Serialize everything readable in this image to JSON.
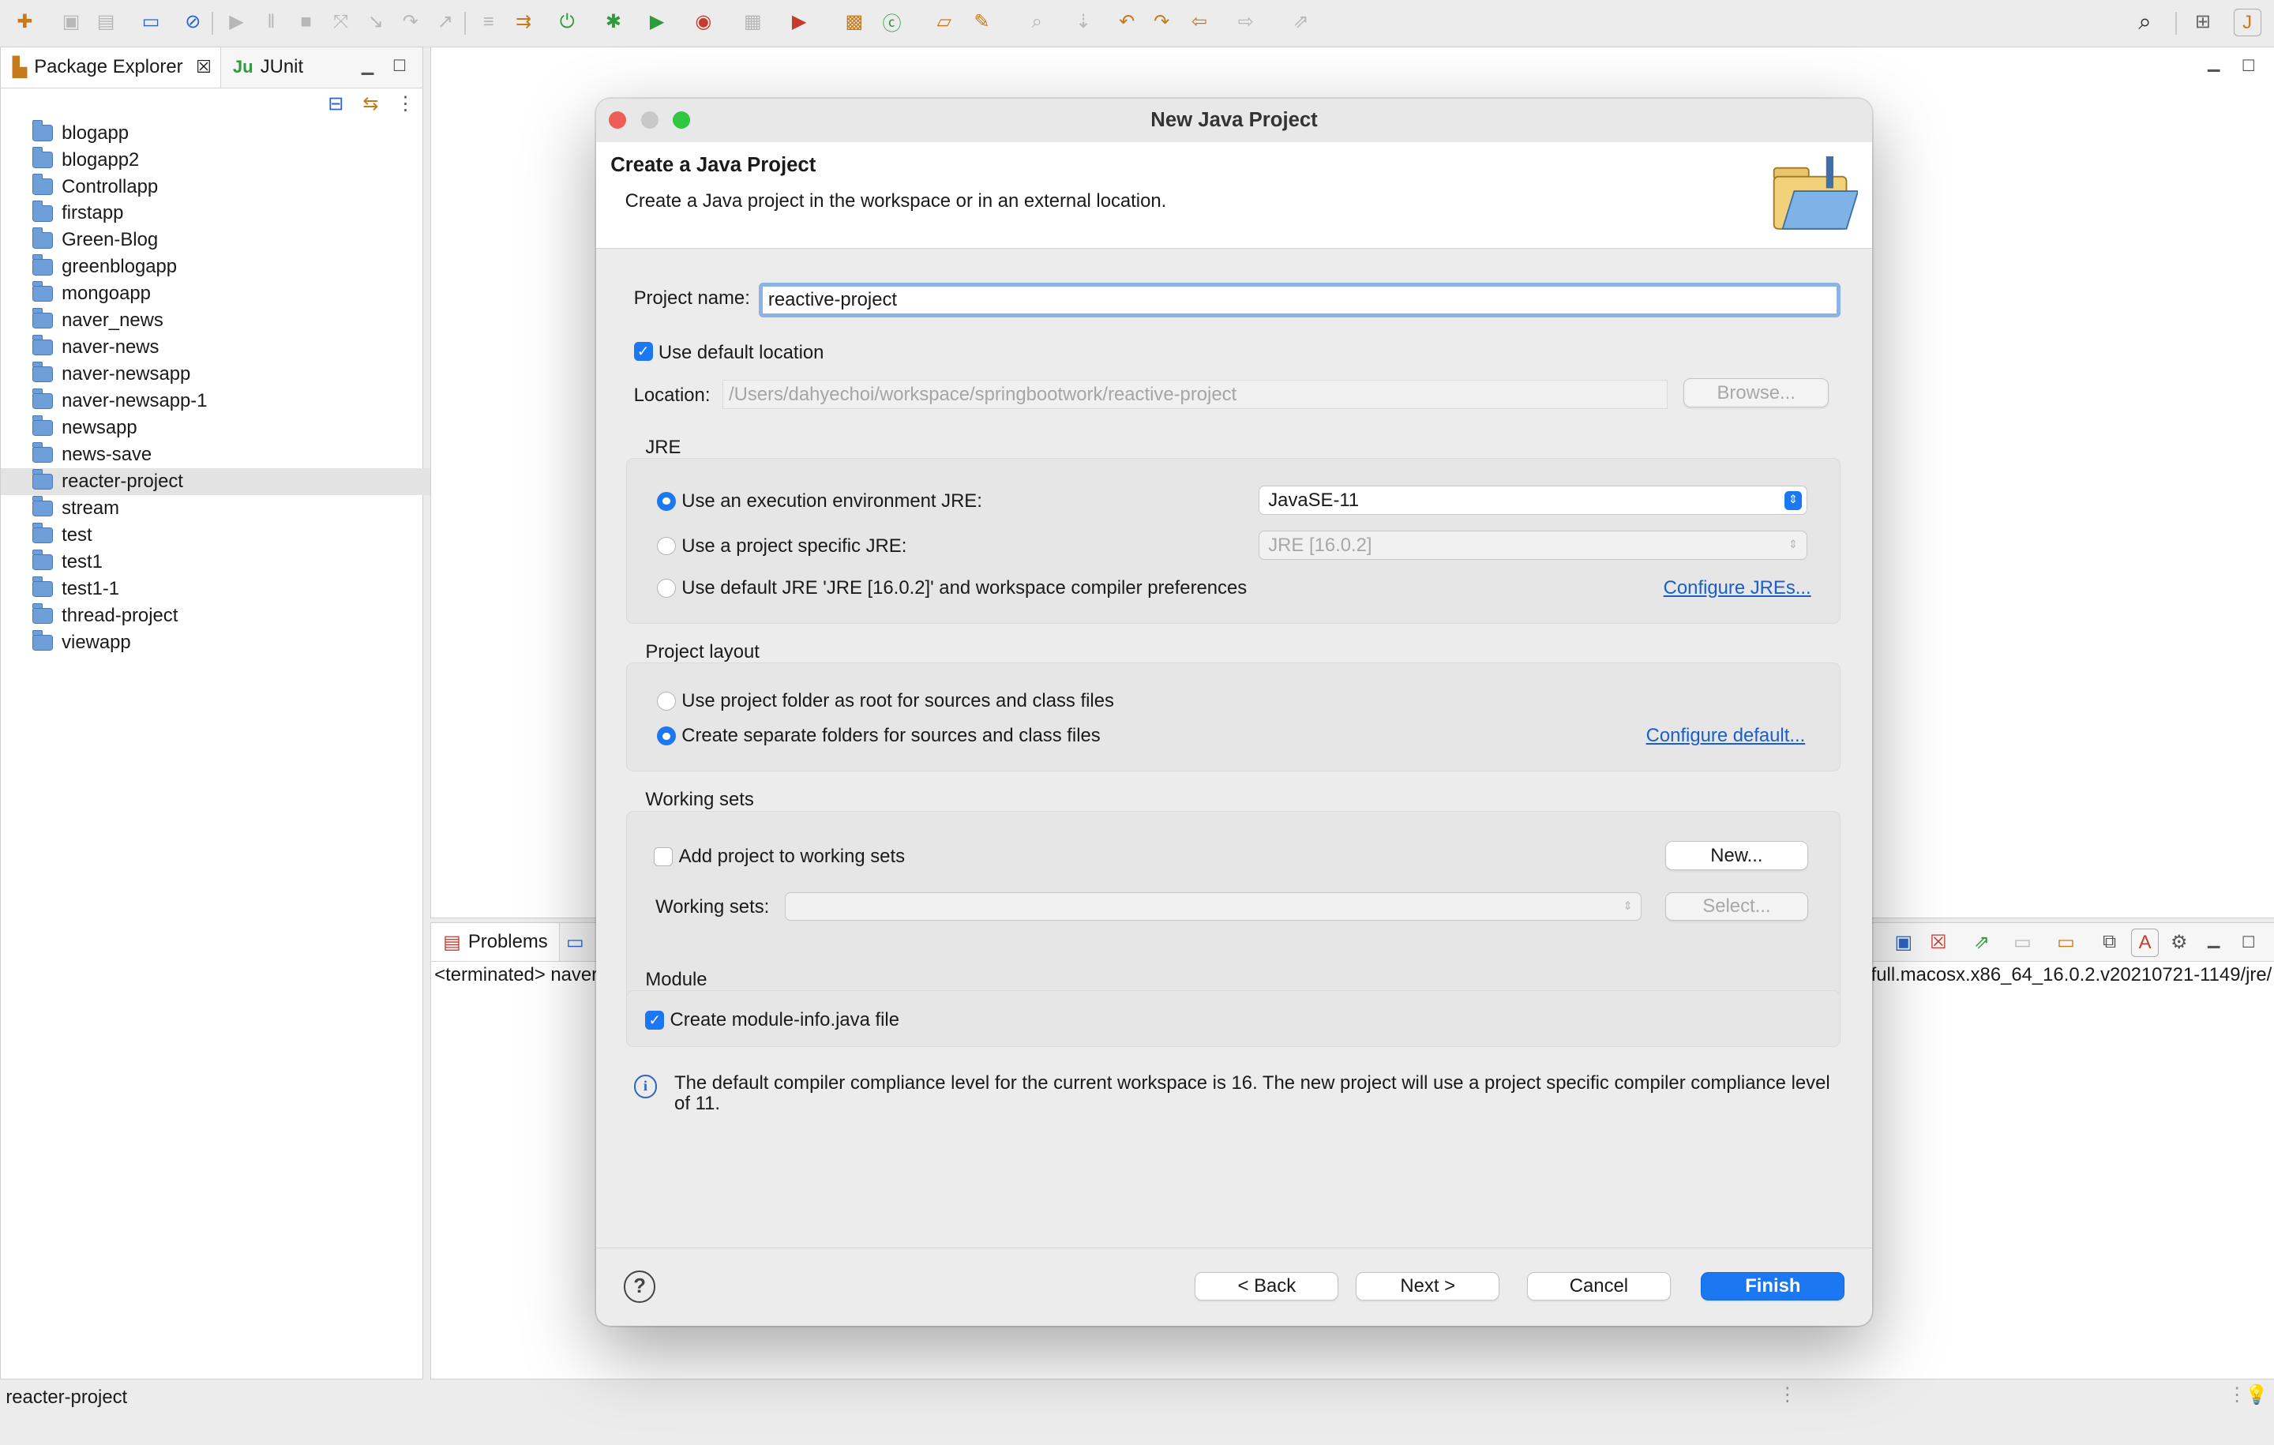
{
  "toolbar": {
    "icons": [
      "new-wizard-icon",
      "save-icon",
      "save-all-icon",
      "terminal-icon",
      "skip-breakpoints-icon",
      "resume-icon",
      "suspend-icon",
      "terminate-icon",
      "disconnect-icon",
      "step-into-icon",
      "step-over-icon",
      "step-return-icon",
      "drop-to-frame-icon",
      "use-step-filters-icon",
      "spring-boot-dashboard-icon",
      "debug-icon",
      "run-icon",
      "coverage-icon",
      "console-icon",
      "external-tools-icon",
      "new-java-package-icon",
      "new-java-class-icon",
      "open-type-icon",
      "open-task-icon",
      "search-icon",
      "annotation-next-icon",
      "annotation-prev-icon",
      "back-icon",
      "forward-icon",
      "pin-editor-icon",
      "search-global-icon",
      "open-perspective-icon",
      "java-perspective-icon"
    ]
  },
  "package_explorer": {
    "tab_label": "Package Explorer",
    "junit_label": "JUnit",
    "junit_badge": "Ju",
    "projects": [
      "blogapp",
      "blogapp2",
      "Controllapp",
      "firstapp",
      "Green-Blog",
      "greenblogapp",
      "mongoapp",
      "naver_news",
      "naver-news",
      "naver-newsapp",
      "naver-newsapp-1",
      "newsapp",
      "news-save",
      "reacter-project",
      "stream",
      "test",
      "test1",
      "test1-1",
      "thread-project",
      "viewapp"
    ],
    "selected": "reacter-project"
  },
  "bottom_panel": {
    "problems_label": "Problems",
    "console_left": "<terminated> naver",
    "console_right": ".full.macosx.x86_64_16.0.2.v20210721-1149/jre/"
  },
  "status": {
    "text": "reacter-project"
  },
  "dialog": {
    "title": "New Java Project",
    "heading": "Create a Java Project",
    "description": "Create a Java project in the workspace or in an external location.",
    "project_name_label": "Project name:",
    "project_name_value": "reactive-project",
    "use_default_location_label": "Use default location",
    "use_default_location_checked": true,
    "location_label": "Location:",
    "location_value": "/Users/dahyechoi/workspace/springbootwork/reactive-project",
    "browse_label": "Browse...",
    "jre_section": "JRE",
    "jre_opt_exec_env": "Use an execution environment JRE:",
    "jre_opt_project_specific": "Use a project specific JRE:",
    "jre_opt_default": "Use default JRE 'JRE [16.0.2]' and workspace compiler preferences",
    "jre_selected_option": "exec_env",
    "exec_env_value": "JavaSE-11",
    "project_jre_value": "JRE [16.0.2]",
    "configure_jres": "Configure JREs...",
    "layout_section": "Project layout",
    "layout_opt_root": "Use project folder as root for sources and class files",
    "layout_opt_separate": "Create separate folders for sources and class files",
    "configure_default": "Configure default...",
    "working_sets_section": "Working sets",
    "add_to_working_sets": "Add project to working sets",
    "add_to_working_sets_checked": false,
    "new_button": "New...",
    "working_sets_label": "Working sets:",
    "working_sets_value": "",
    "select_button": "Select...",
    "module_section": "Module",
    "create_module_info": "Create module-info.java file",
    "create_module_info_checked": true,
    "info_message": "The default compiler compliance level for the current workspace is 16. The new project will use a project specific compiler compliance level of 11.",
    "back_button": "< Back",
    "next_button": "Next >",
    "cancel_button": "Cancel",
    "finish_button": "Finish",
    "help_glyph": "?",
    "info_glyph": "i"
  },
  "colors": {
    "accent": "#1c78f2",
    "link": "#1a5fc7",
    "close_light": "#ed5f56",
    "minimize_light": "#c8c8c8",
    "zoom_light": "#2fc640",
    "selection": "#e3e3e3"
  }
}
